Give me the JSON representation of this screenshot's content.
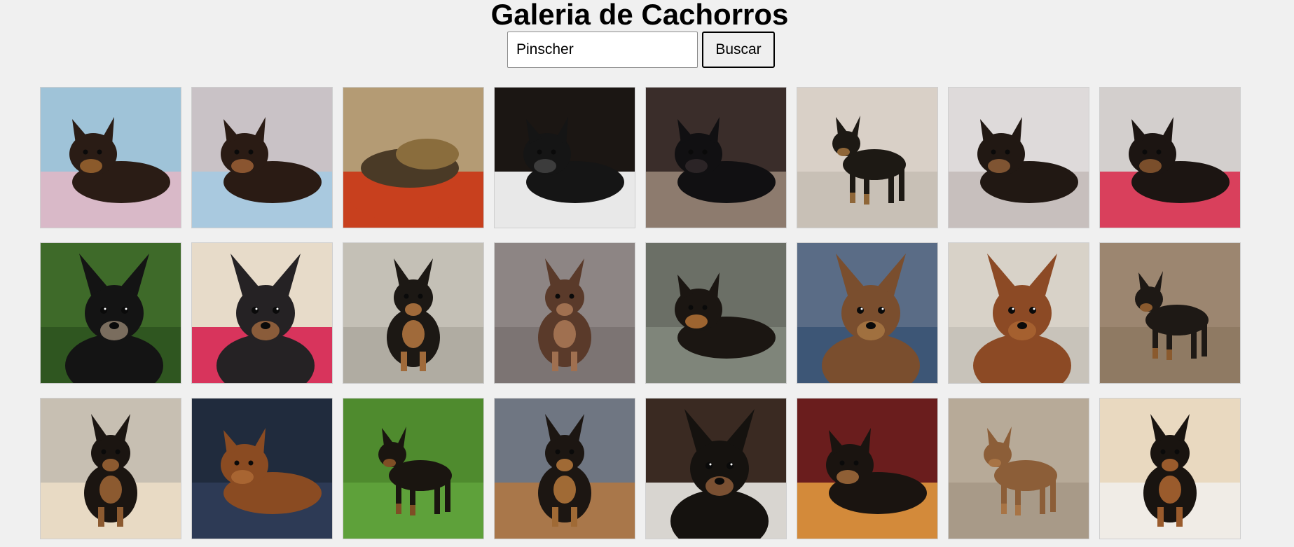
{
  "header": {
    "title": "Galeria de Cachorros"
  },
  "search": {
    "value": "Pinscher",
    "button_label": "Buscar"
  },
  "gallery": {
    "images": [
      {
        "bg": "#9fc3d8",
        "floor": "#d9b9c8",
        "dog": "#2a1c15",
        "tan": "#8b5a2b",
        "pose": "lying"
      },
      {
        "bg": "#c9c2c6",
        "floor": "#a9c9df",
        "dog": "#2a1b14",
        "tan": "#8a5530",
        "pose": "lying"
      },
      {
        "bg": "#b49b74",
        "floor": "#c8401e",
        "dog": "#4a3a26",
        "tan": "#8a6d3d",
        "pose": "bed"
      },
      {
        "bg": "#1b1613",
        "floor": "#e8e8e8",
        "dog": "#151515",
        "tan": "#3c3c3c",
        "pose": "lying"
      },
      {
        "bg": "#3a2d2a",
        "floor": "#8d7b6e",
        "dog": "#111012",
        "tan": "#2b2426",
        "pose": "lying"
      },
      {
        "bg": "#d9d0c7",
        "floor": "#c8c0b6",
        "dog": "#1d1914",
        "tan": "#8f6638",
        "pose": "standing"
      },
      {
        "bg": "#dedada",
        "floor": "#c7bfbd",
        "dog": "#211813",
        "tan": "#7f5432",
        "pose": "lying"
      },
      {
        "bg": "#d3cfcd",
        "floor": "#d9405c",
        "dog": "#1c1512",
        "tan": "#7a4e2b",
        "pose": "lying"
      },
      {
        "bg": "#3e6a29",
        "floor": "#2f5620",
        "dog": "#141414",
        "tan": "#7a6d5e",
        "pose": "portrait"
      },
      {
        "bg": "#e7dbc9",
        "floor": "#d8345c",
        "dog": "#252224",
        "tan": "#8a5c3a",
        "pose": "portrait"
      },
      {
        "bg": "#c4c0b6",
        "floor": "#b0aca2",
        "dog": "#1c1814",
        "tan": "#a06a3a",
        "pose": "sitting"
      },
      {
        "bg": "#8d8584",
        "floor": "#7c7473",
        "dog": "#5a3a2a",
        "tan": "#a07050",
        "pose": "sitting"
      },
      {
        "bg": "#6b6f66",
        "floor": "#7f857a",
        "dog": "#1b1612",
        "tan": "#9d6430",
        "pose": "lying"
      },
      {
        "bg": "#5a6c86",
        "floor": "#3d5676",
        "dog": "#7a4e2e",
        "tan": "#a0703f",
        "pose": "portrait"
      },
      {
        "bg": "#d8d2c8",
        "floor": "#c8c3ba",
        "dog": "#8c4a25",
        "tan": "#a5602f",
        "pose": "portrait"
      },
      {
        "bg": "#9c8670",
        "floor": "#8f7a63",
        "dog": "#1e1915",
        "tan": "#8a5a2e",
        "pose": "standing"
      },
      {
        "bg": "#c7bfb2",
        "floor": "#e8dac4",
        "dog": "#1b1511",
        "tan": "#8c5a30",
        "pose": "sitting"
      },
      {
        "bg": "#202b3d",
        "floor": "#2d3a55",
        "dog": "#8a4b22",
        "tan": "#a86532",
        "pose": "lying"
      },
      {
        "bg": "#4f8b2e",
        "floor": "#5ea13a",
        "dog": "#1a1510",
        "tan": "#7f4e25",
        "pose": "standing"
      },
      {
        "bg": "#6f7682",
        "floor": "#a9774a",
        "dog": "#1c1612",
        "tan": "#a06a35",
        "pose": "sitting"
      },
      {
        "bg": "#3a2a22",
        "floor": "#d8d5d0",
        "dog": "#15120f",
        "tan": "#7a5032",
        "pose": "portrait"
      },
      {
        "bg": "#6a1d1d",
        "floor": "#d38a3a",
        "dog": "#1a1410",
        "tan": "#8f5f35",
        "pose": "lying"
      },
      {
        "bg": "#b7aa98",
        "floor": "#a89a88",
        "dog": "#8c5e38",
        "tan": "#a87445",
        "pose": "standing"
      },
      {
        "bg": "#e9d9c0",
        "floor": "#f0ece6",
        "dog": "#191410",
        "tan": "#9a5b2c",
        "pose": "sitting"
      }
    ]
  }
}
